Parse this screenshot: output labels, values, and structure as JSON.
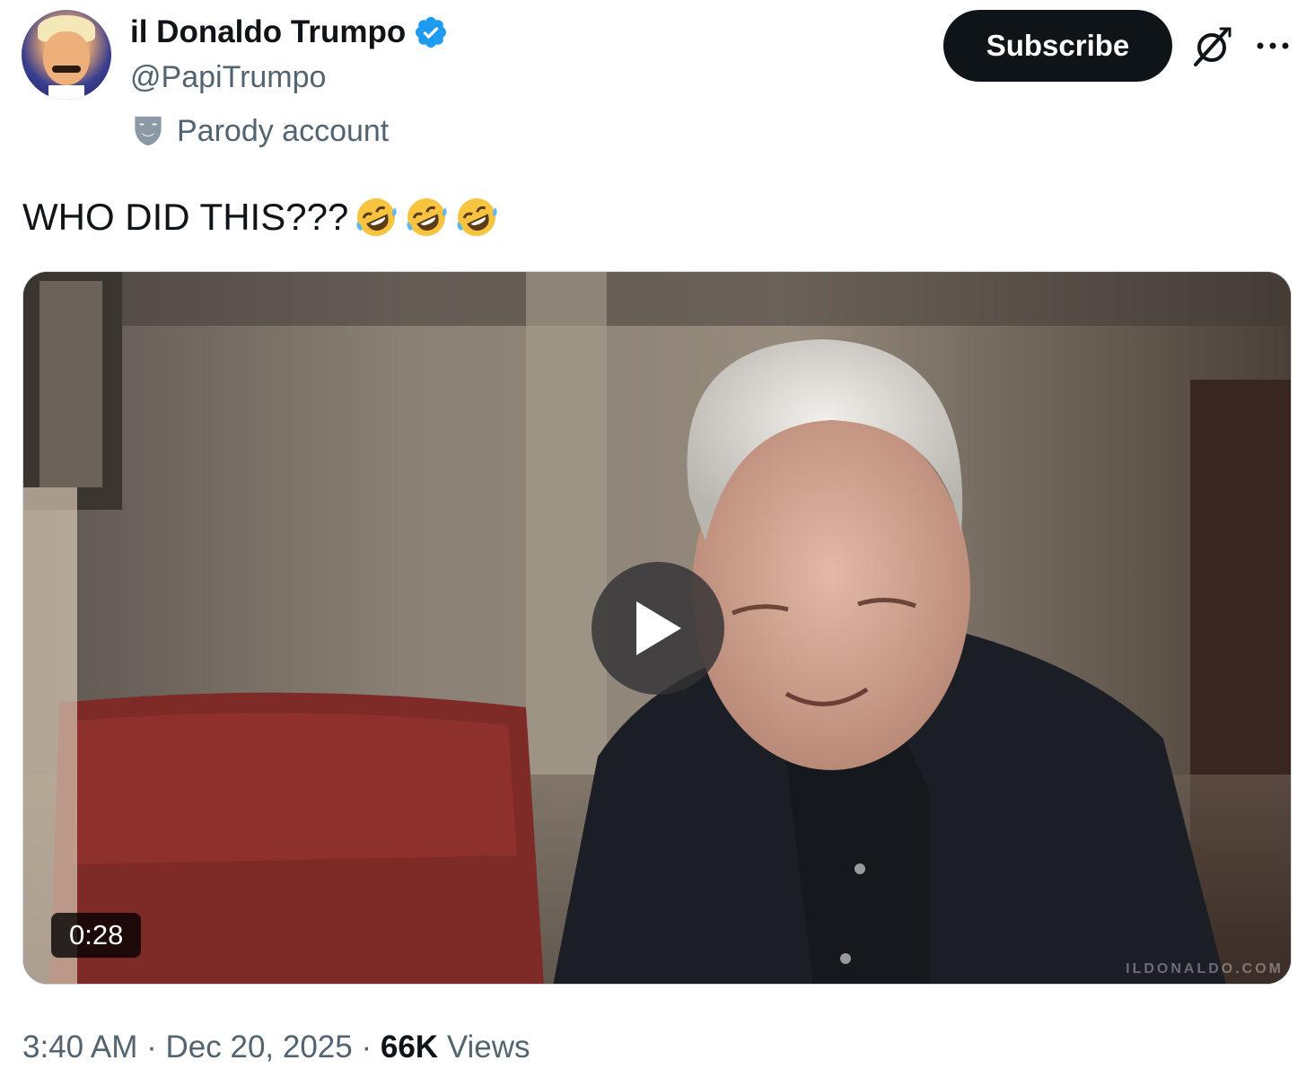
{
  "author": {
    "display_name": "il Donaldo Trumpo",
    "handle": "@PapiTrumpo",
    "verified": true,
    "label_icon": "parody-mask-icon",
    "label": "Parody account"
  },
  "actions": {
    "subscribe_label": "Subscribe",
    "grok_icon": "grok-icon",
    "more_icon": "more-icon"
  },
  "tweet": {
    "text": "WHO DID THIS???",
    "emojis": [
      "rolling-on-the-floor-laughing",
      "rolling-on-the-floor-laughing",
      "rolling-on-the-floor-laughing"
    ]
  },
  "media": {
    "type": "video",
    "duration": "0:28",
    "watermark": "ILDONALDO.COM",
    "play_icon": "play-icon"
  },
  "meta": {
    "time": "3:40 AM",
    "separator": " · ",
    "date": "Dec 20, 2025",
    "views_count": "66K",
    "views_label": "Views"
  },
  "colors": {
    "text_primary": "#0f1419",
    "text_secondary": "#536471",
    "verified_blue": "#1d9bf0",
    "button_dark": "#0f1419"
  }
}
